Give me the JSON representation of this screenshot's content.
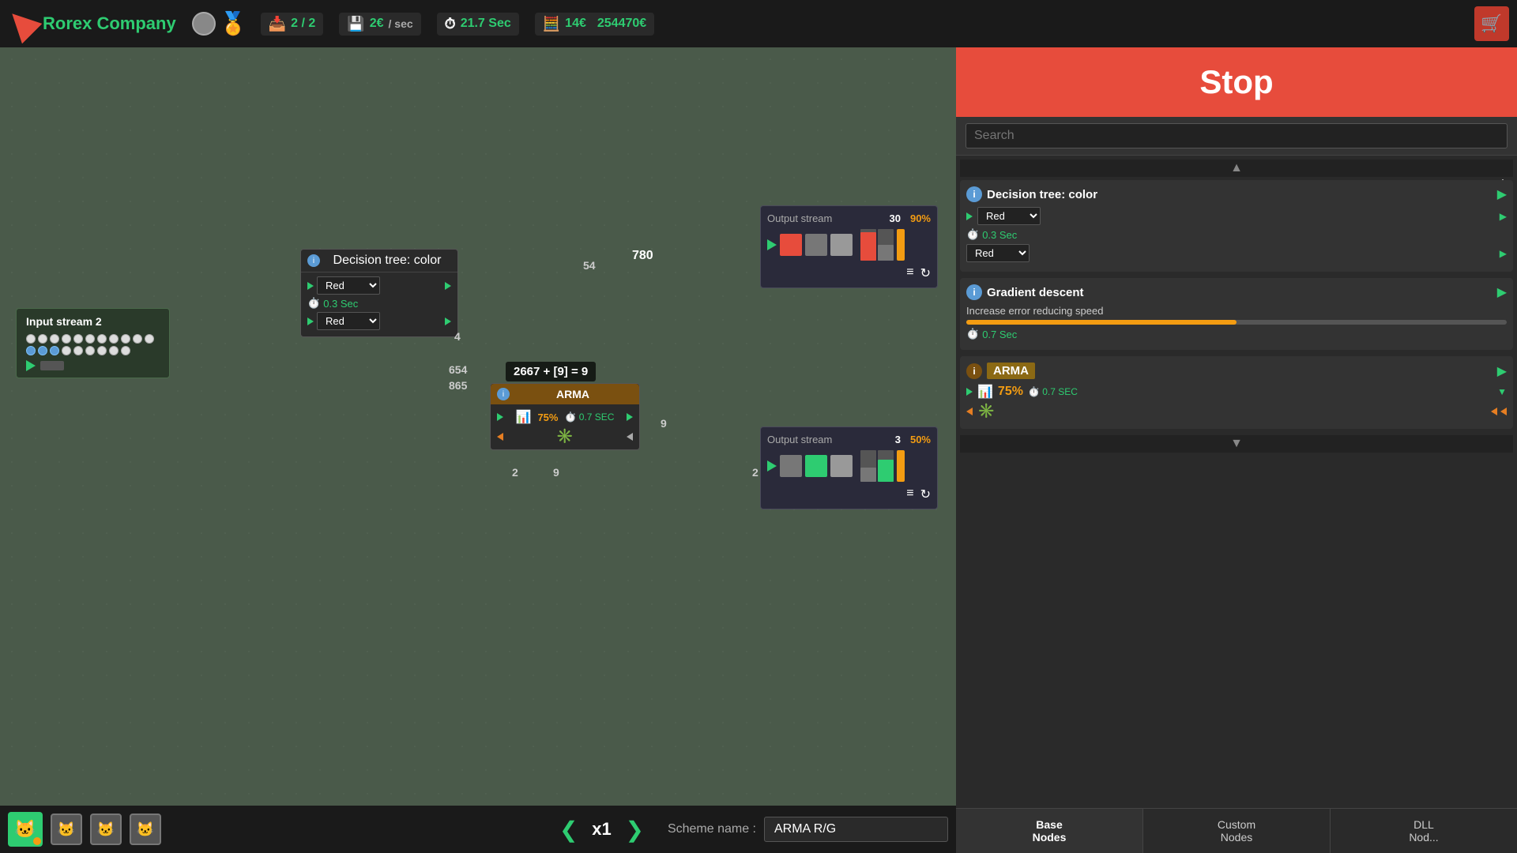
{
  "app": {
    "company": "Rorex Company",
    "stop_label": "Stop",
    "search_placeholder": "Search"
  },
  "topbar": {
    "agents": "2 / 2",
    "rate": "2",
    "rate_unit": "/ sec",
    "timer": "21.7 Sec",
    "calc_value": "14",
    "total": "254470",
    "currency": "€"
  },
  "bottombar": {
    "speed_label": "x1",
    "scheme_label": "Scheme name :",
    "scheme_name": "ARMA R/G"
  },
  "sidebar": {
    "tabs": [
      {
        "id": "base",
        "label": "Base\nNodes"
      },
      {
        "id": "custom",
        "label": "Custom\nNodes"
      },
      {
        "id": "dll",
        "label": "DLL\nNod..."
      }
    ],
    "nodes": [
      {
        "id": "decision-tree",
        "type": "decision_tree",
        "title": "Decision tree: color",
        "dropdown1": "Red",
        "dropdown2": "Red",
        "speed": "0.3 Sec"
      },
      {
        "id": "gradient-descent",
        "type": "gradient",
        "title": "Gradient descent",
        "subtitle": "Increase error reducing speed",
        "speed": "0.7 Sec"
      },
      {
        "id": "arma",
        "type": "arma",
        "title": "ARMA",
        "percent": "75%",
        "speed": "0.7 SEC"
      }
    ]
  },
  "canvas": {
    "input_stream": {
      "label": "Input stream 2"
    },
    "formula": "2667 + [9] = 9",
    "arma_node": {
      "title": "ARMA",
      "percent": "75%",
      "speed": "0.7 SEC"
    },
    "dt_node": {
      "title": "Decision tree: color",
      "dropdown1": "Red",
      "dropdown2": "Red",
      "speed": "0.3 Sec"
    },
    "output1": {
      "label": "Output stream",
      "count": "30",
      "percent": "90%"
    },
    "output2": {
      "label": "Output stream",
      "count": "3",
      "percent": "50%"
    },
    "labels": {
      "v54": "54",
      "v780": "780",
      "v4": "4",
      "v654": "654",
      "v865": "865",
      "v2a": "2",
      "v9a": "9",
      "v9b": "9",
      "v2b": "2"
    }
  }
}
